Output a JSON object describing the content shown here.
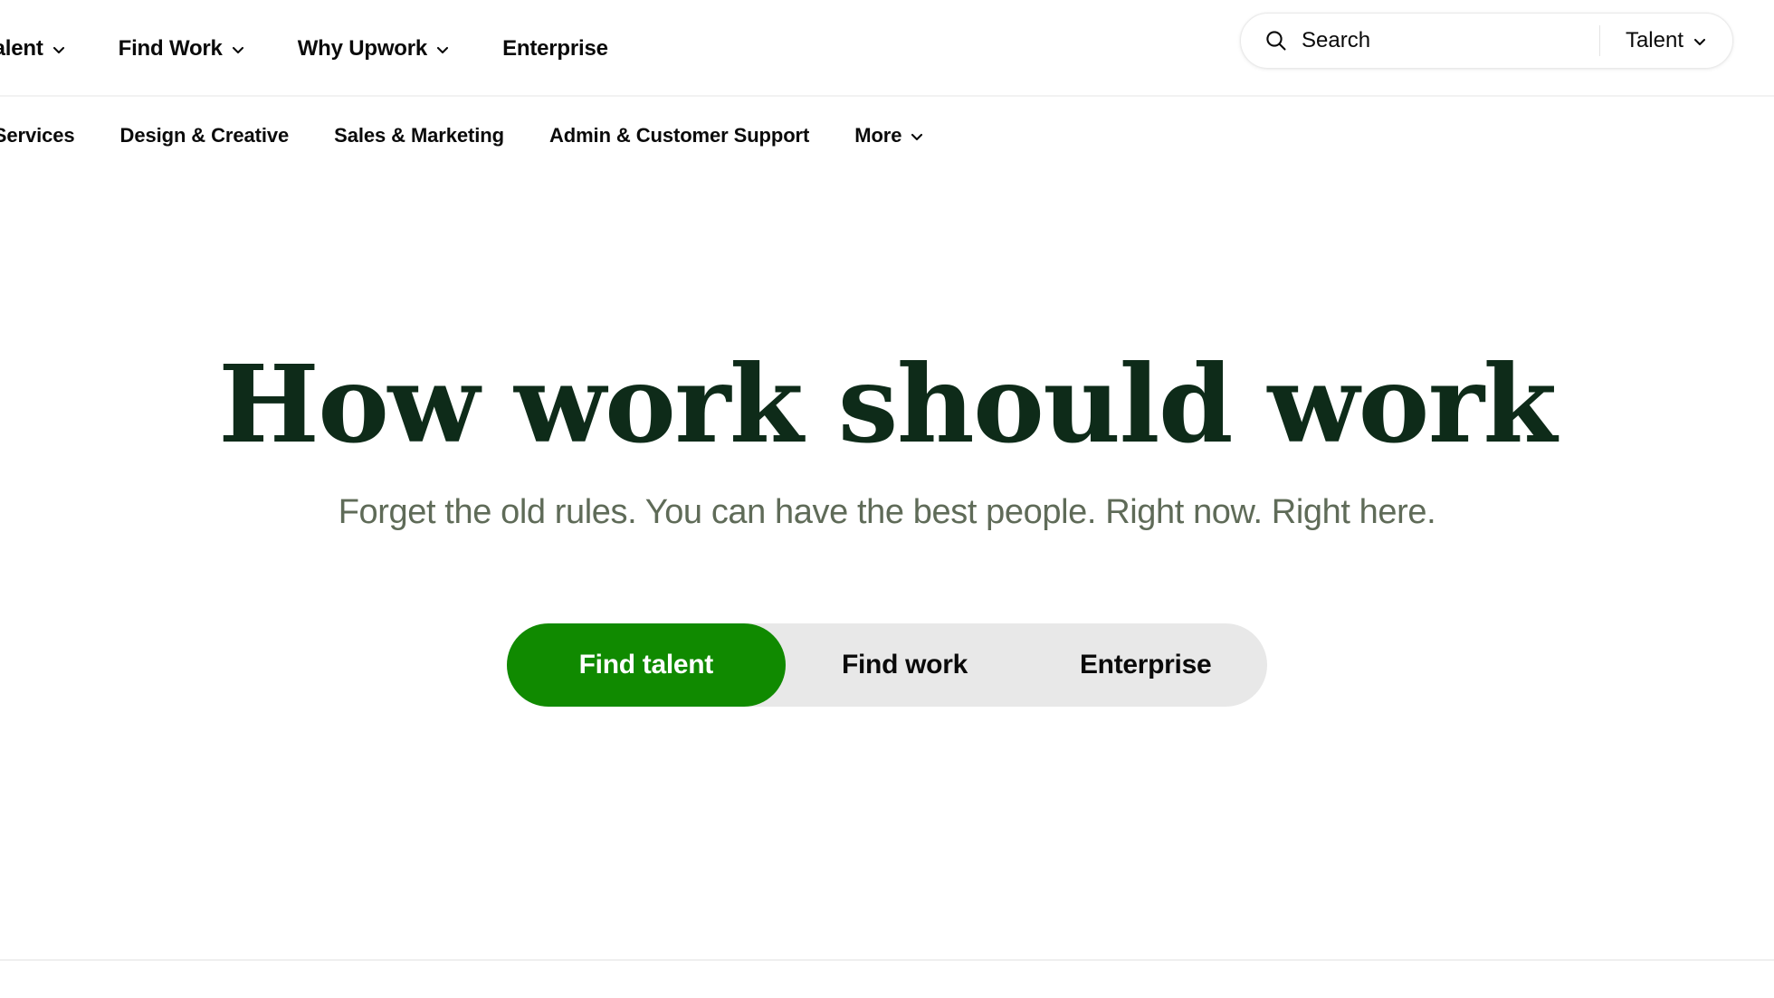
{
  "colors": {
    "brand_green": "#108a00",
    "headline_green": "#0e2b19",
    "subhead_gray": "#5f6b58",
    "track_gray": "#e8e8e8",
    "divider": "#f2f2f2",
    "page_bg": "#ffffff"
  },
  "topnav": {
    "items": [
      {
        "label": "d Talent",
        "has_chevron": true
      },
      {
        "label": "Find Work",
        "has_chevron": true
      },
      {
        "label": "Why Upwork",
        "has_chevron": true
      },
      {
        "label": "Enterprise",
        "has_chevron": false
      }
    ]
  },
  "search": {
    "icon": "search-icon",
    "placeholder": "Search",
    "value": "",
    "scope_label": "Talent",
    "scope_chevron": "chevron-down-icon"
  },
  "catnav": {
    "items": [
      {
        "label": "AI Services",
        "has_chevron": false
      },
      {
        "label": "Design & Creative",
        "has_chevron": false
      },
      {
        "label": "Sales & Marketing",
        "has_chevron": false
      },
      {
        "label": "Admin & Customer Support",
        "has_chevron": false
      },
      {
        "label": "More",
        "has_chevron": true
      }
    ]
  },
  "hero": {
    "title": "How work should work",
    "subtitle": "Forget the old rules. You can have the best people. Right now. Right here."
  },
  "segmented_control": {
    "options": [
      {
        "label": "Find talent",
        "active": true
      },
      {
        "label": "Find work",
        "active": false
      },
      {
        "label": "Enterprise",
        "active": false
      }
    ]
  }
}
